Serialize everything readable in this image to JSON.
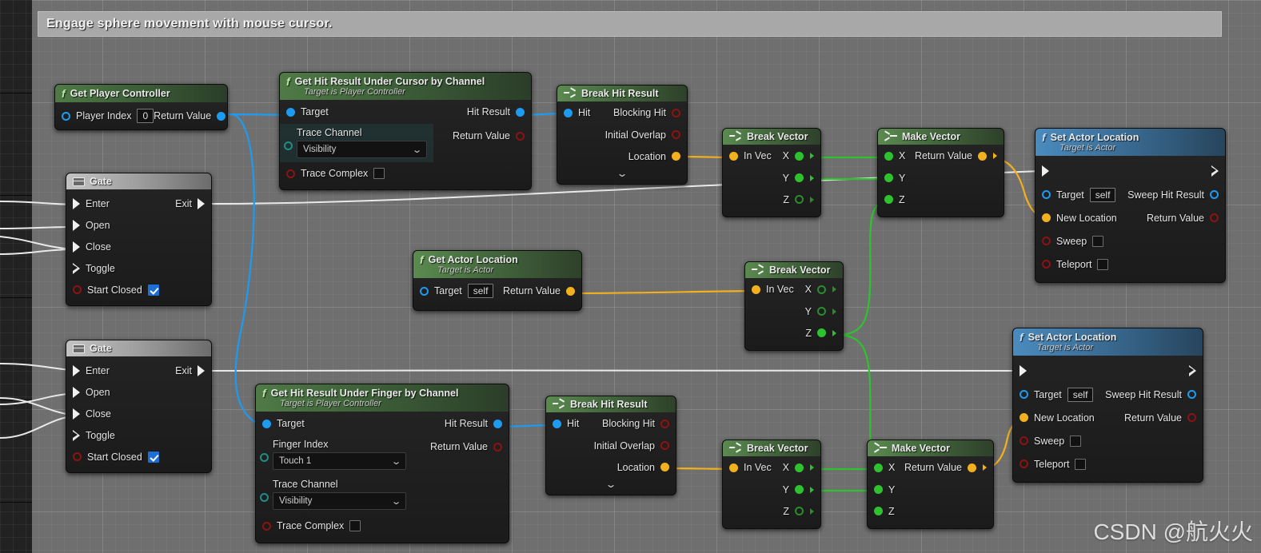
{
  "comment": {
    "text": "Engage sphere movement with mouse cursor."
  },
  "watermark": {
    "text": "CSDN @航火火"
  },
  "icons": {
    "function": "f",
    "gate": "gate-icon",
    "break": "break-struct-icon",
    "make": "make-struct-icon",
    "chevron_down": "⌄"
  },
  "colors": {
    "exec_wire": "#f2f2f2",
    "object_wire": "#1d9bf0",
    "struct_wire": "#f2b01e",
    "float_wire": "#2fc22f",
    "canvas": "#6f6f6f",
    "function_header": "#4f7a46",
    "setter_header": "#4a8bbe",
    "gate_header": "#b0b0b0"
  },
  "nodes": {
    "get_player_controller": {
      "title": "Get Player Controller",
      "inputs": [
        {
          "label": "Player Index",
          "value": "0"
        }
      ],
      "outputs": [
        {
          "label": "Return Value"
        }
      ]
    },
    "gate_top": {
      "title": "Gate",
      "inputs": [
        {
          "label": "Enter"
        },
        {
          "label": "Open"
        },
        {
          "label": "Close"
        },
        {
          "label": "Toggle"
        },
        {
          "label": "Start Closed",
          "value": "checked"
        }
      ],
      "outputs": [
        {
          "label": "Exit"
        }
      ]
    },
    "gate_bottom": {
      "title": "Gate",
      "inputs": [
        {
          "label": "Enter"
        },
        {
          "label": "Open"
        },
        {
          "label": "Close"
        },
        {
          "label": "Toggle"
        },
        {
          "label": "Start Closed",
          "value": "checked"
        }
      ],
      "outputs": [
        {
          "label": "Exit"
        }
      ]
    },
    "hit_under_cursor": {
      "title": "Get Hit Result Under Cursor by Channel",
      "subtitle": "Target is Player Controller",
      "inputs": [
        {
          "label": "Target"
        },
        {
          "label": "Trace Channel",
          "value": "Visibility"
        },
        {
          "label": "Trace Complex",
          "value": "unchecked"
        }
      ],
      "outputs": [
        {
          "label": "Hit Result"
        },
        {
          "label": "Return Value"
        }
      ]
    },
    "hit_under_finger": {
      "title": "Get Hit Result Under Finger by Channel",
      "subtitle": "Target is Player Controller",
      "inputs": [
        {
          "label": "Target"
        },
        {
          "label": "Finger Index",
          "value": "Touch 1"
        },
        {
          "label": "Trace Channel",
          "value": "Visibility"
        },
        {
          "label": "Trace Complex",
          "value": "unchecked"
        }
      ],
      "outputs": [
        {
          "label": "Hit Result"
        },
        {
          "label": "Return Value"
        }
      ]
    },
    "break_hit_result_top": {
      "title": "Break Hit Result",
      "inputs": [
        {
          "label": "Hit"
        }
      ],
      "outputs": [
        {
          "label": "Blocking Hit"
        },
        {
          "label": "Initial Overlap"
        },
        {
          "label": "Location"
        }
      ]
    },
    "break_hit_result_bottom": {
      "title": "Break Hit Result",
      "inputs": [
        {
          "label": "Hit"
        }
      ],
      "outputs": [
        {
          "label": "Blocking Hit"
        },
        {
          "label": "Initial Overlap"
        },
        {
          "label": "Location"
        }
      ]
    },
    "get_actor_location": {
      "title": "Get Actor Location",
      "subtitle": "Target is Actor",
      "inputs": [
        {
          "label": "Target",
          "value": "self"
        }
      ],
      "outputs": [
        {
          "label": "Return Value"
        }
      ]
    },
    "break_vector_top": {
      "title": "Break Vector",
      "inputs": [
        {
          "label": "In Vec"
        }
      ],
      "outputs": [
        {
          "label": "X"
        },
        {
          "label": "Y"
        },
        {
          "label": "Z"
        }
      ]
    },
    "break_vector_mid": {
      "title": "Break Vector",
      "inputs": [
        {
          "label": "In Vec"
        }
      ],
      "outputs": [
        {
          "label": "X"
        },
        {
          "label": "Y"
        },
        {
          "label": "Z"
        }
      ]
    },
    "break_vector_bottom": {
      "title": "Break Vector",
      "inputs": [
        {
          "label": "In Vec"
        }
      ],
      "outputs": [
        {
          "label": "X"
        },
        {
          "label": "Y"
        },
        {
          "label": "Z"
        }
      ]
    },
    "make_vector_top": {
      "title": "Make Vector",
      "inputs": [
        {
          "label": "X"
        },
        {
          "label": "Y"
        },
        {
          "label": "Z"
        }
      ],
      "outputs": [
        {
          "label": "Return Value"
        }
      ]
    },
    "make_vector_bottom": {
      "title": "Make Vector",
      "inputs": [
        {
          "label": "X"
        },
        {
          "label": "Y"
        },
        {
          "label": "Z"
        }
      ],
      "outputs": [
        {
          "label": "Return Value"
        }
      ]
    },
    "set_actor_location_top": {
      "title": "Set Actor Location",
      "subtitle": "Target is Actor",
      "inputs": [
        {
          "label": "Target",
          "value": "self"
        },
        {
          "label": "New Location"
        },
        {
          "label": "Sweep",
          "value": "unchecked"
        },
        {
          "label": "Teleport",
          "value": "unchecked"
        }
      ],
      "outputs": [
        {
          "label": "Sweep Hit Result"
        },
        {
          "label": "Return Value"
        }
      ]
    },
    "set_actor_location_bottom": {
      "title": "Set Actor Location",
      "subtitle": "Target is Actor",
      "inputs": [
        {
          "label": "Target",
          "value": "self"
        },
        {
          "label": "New Location"
        },
        {
          "label": "Sweep",
          "value": "unchecked"
        },
        {
          "label": "Teleport",
          "value": "unchecked"
        }
      ],
      "outputs": [
        {
          "label": "Sweep Hit Result"
        },
        {
          "label": "Return Value"
        }
      ]
    }
  }
}
